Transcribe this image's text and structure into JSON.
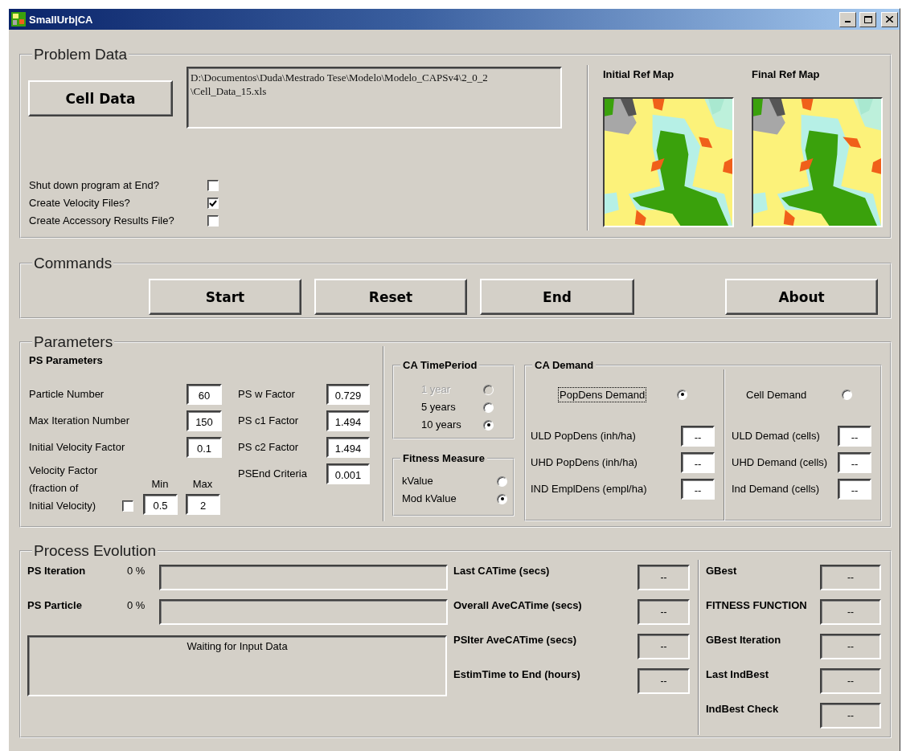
{
  "window": {
    "title": "SmallUrb|CA"
  },
  "problem_data": {
    "title": "Problem Data",
    "cell_data_button": "Cell Data",
    "file_path": "D:\\Documentos\\Duda\\Mestrado Tese\\Modelo\\Modelo_CAPSv4\\2_0_2\n\\Cell_Data_15.xls",
    "options": [
      {
        "label": "Shut down program at End?",
        "checked": false
      },
      {
        "label": "Create Velocity Files?",
        "checked": true
      },
      {
        "label": "Create Accessory Results File?",
        "checked": false
      }
    ],
    "maps": [
      {
        "title": "Initial Ref Map",
        "kind": "picture"
      },
      {
        "title": "Final Ref Map",
        "kind": "picture"
      }
    ]
  },
  "commands": {
    "title": "Commands",
    "buttons": [
      "Start",
      "Reset",
      "End",
      "About"
    ]
  },
  "parameters": {
    "title": "Parameters",
    "ps": {
      "title": "PS Parameters",
      "left_fields": [
        {
          "label": "Particle Number",
          "value": "60"
        },
        {
          "label": "Max Iteration Number",
          "value": "150"
        },
        {
          "label": "Initial Velocity Factor",
          "value": "0.1"
        }
      ],
      "velocity": {
        "label": "Velocity Factor\n(fraction of\nInitial Velocity)",
        "checked": false,
        "min_label": "Min",
        "max_label": "Max",
        "min": "0.5",
        "max": "2"
      },
      "right_fields": [
        {
          "label": "PS w Factor",
          "value": "0.729"
        },
        {
          "label": "PS c1 Factor",
          "value": "1.494"
        },
        {
          "label": "PS c2 Factor",
          "value": "1.494"
        },
        {
          "label": "PSEnd Criteria",
          "value": "0.001"
        }
      ]
    },
    "time_period": {
      "title": "CA TimePeriod",
      "options": [
        {
          "label": "1 year",
          "selected": false,
          "disabled": true
        },
        {
          "label": "5 years",
          "selected": false,
          "disabled": false
        },
        {
          "label": "10 years",
          "selected": true,
          "disabled": false
        }
      ]
    },
    "fitness": {
      "title": "Fitness Measure",
      "options": [
        {
          "label": "kValue",
          "selected": false
        },
        {
          "label": "Mod kValue",
          "selected": true
        }
      ]
    },
    "demand": {
      "title": "CA Demand",
      "modes": [
        {
          "label": "PopDens Demand",
          "selected": true,
          "focused": true
        },
        {
          "label": "Cell Demand",
          "selected": false,
          "focused": false
        }
      ],
      "pop_fields": [
        {
          "label": "ULD PopDens (inh/ha)",
          "value": "--"
        },
        {
          "label": "UHD PopDens (inh/ha)",
          "value": "--"
        },
        {
          "label": "IND EmplDens (empl/ha)",
          "value": "--"
        }
      ],
      "cell_fields": [
        {
          "label": "ULD Demad (cells)",
          "value": "--"
        },
        {
          "label": "UHD Demand (cells)",
          "value": "--"
        },
        {
          "label": "Ind Demand (cells)",
          "value": "--"
        }
      ]
    }
  },
  "process": {
    "title": "Process Evolution",
    "progress": [
      {
        "label": "PS Iteration",
        "percent": "0 %",
        "level": 0
      },
      {
        "label": "PS Particle",
        "percent": "0 %",
        "level": 0
      }
    ],
    "status": "Waiting for Input Data",
    "times": [
      {
        "label": "Last CATime (secs)",
        "value": "--"
      },
      {
        "label": "Overall AveCATime (secs)",
        "value": "--"
      },
      {
        "label": "PSIter AveCATime (secs)",
        "value": "--"
      },
      {
        "label": "EstimTime to End  (hours)",
        "value": "--"
      }
    ],
    "results": [
      {
        "label": "GBest",
        "value": "--"
      },
      {
        "label": "FITNESS FUNCTION",
        "value": "--"
      },
      {
        "label": "GBest Iteration",
        "value": "--"
      },
      {
        "label": "Last IndBest",
        "value": "--"
      },
      {
        "label": "IndBest Check",
        "value": "--"
      }
    ]
  }
}
